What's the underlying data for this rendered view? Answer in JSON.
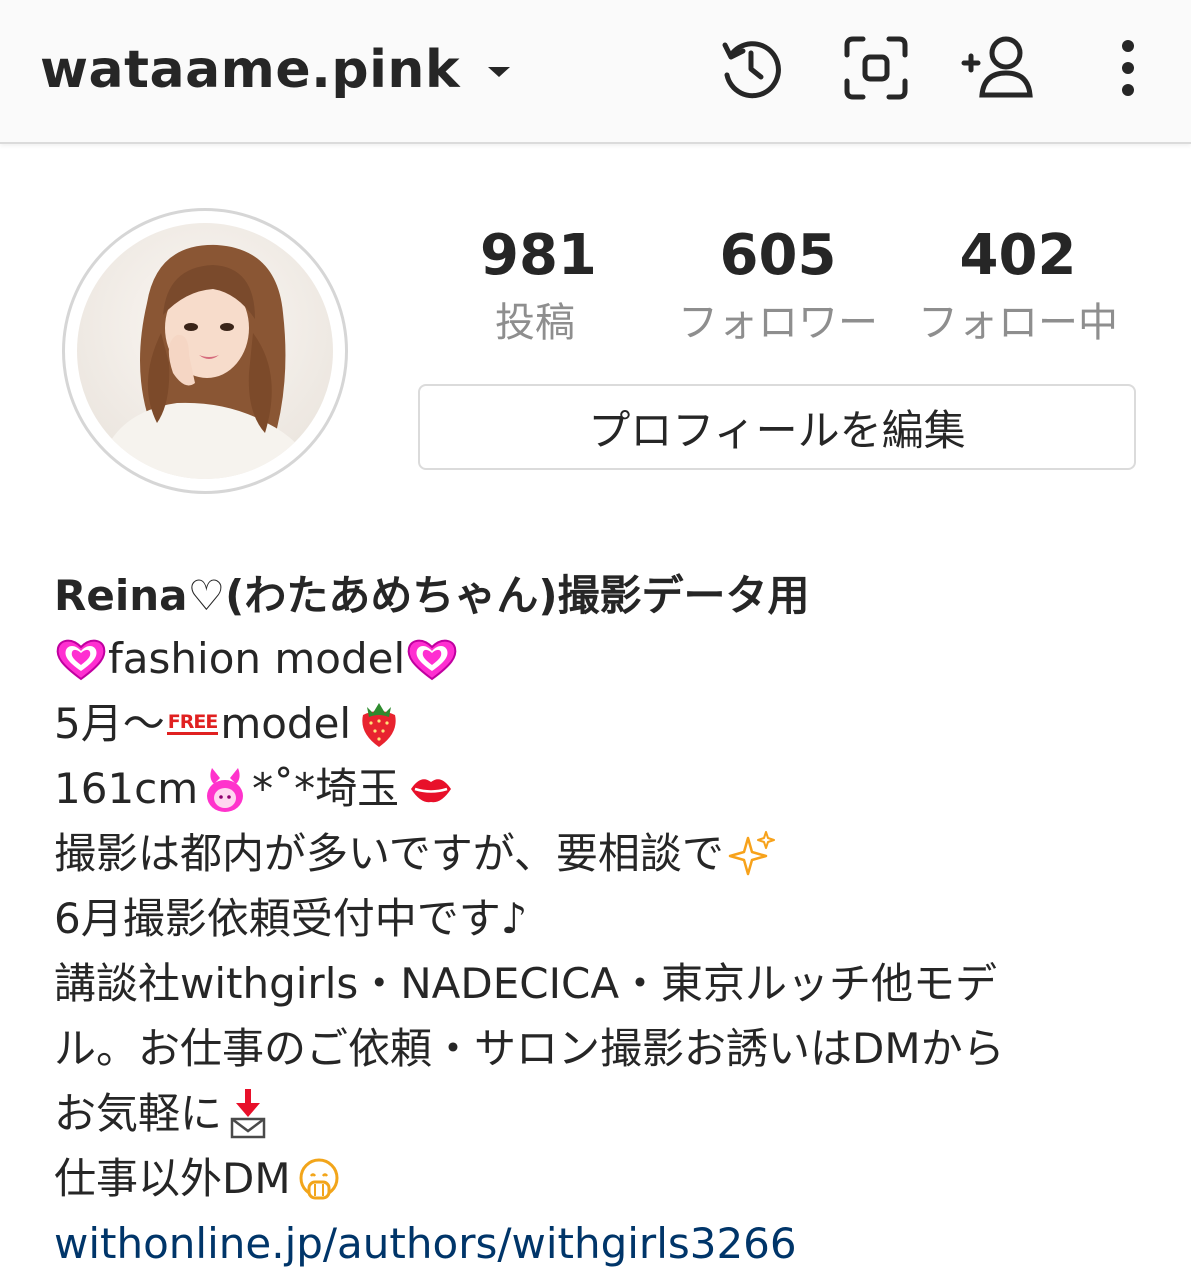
{
  "header": {
    "username": "wataame.pink",
    "icons": [
      "history-icon",
      "scan-icon",
      "add-person-icon",
      "more-vertical-icon"
    ]
  },
  "profile": {
    "stats": [
      {
        "value": "981",
        "label": "投稿"
      },
      {
        "value": "605",
        "label": "フォロワー"
      },
      {
        "value": "402",
        "label": "フォロー中"
      }
    ],
    "edit_button": "プロフィールを編集"
  },
  "bio": {
    "name": "Reina♡(わたあめちゃん)撮影データ用",
    "line1": "fashion model",
    "line2_prefix": "5月〜",
    "line2_free": "FREE",
    "line2_suffix": "model",
    "line3_prefix": "161cm",
    "line3_mid": "*˚*埼玉",
    "line4": "撮影は都内が多いですが、要相談で",
    "line5": "6月撮影依頼受付中です♪",
    "line6": "講談社withgirls・NADECICA・東京ルッチ他モデ",
    "line7": "ル。お仕事のご依頼・サロン撮影お誘いはDMから",
    "line8": "お気軽に",
    "line9": "仕事以外DM",
    "link": "withonline.jp/authors/withgirls3266"
  },
  "colors": {
    "text": "#262626",
    "muted": "#8e8e8e",
    "link": "#003569",
    "heart_pink": "#ff33cc"
  }
}
